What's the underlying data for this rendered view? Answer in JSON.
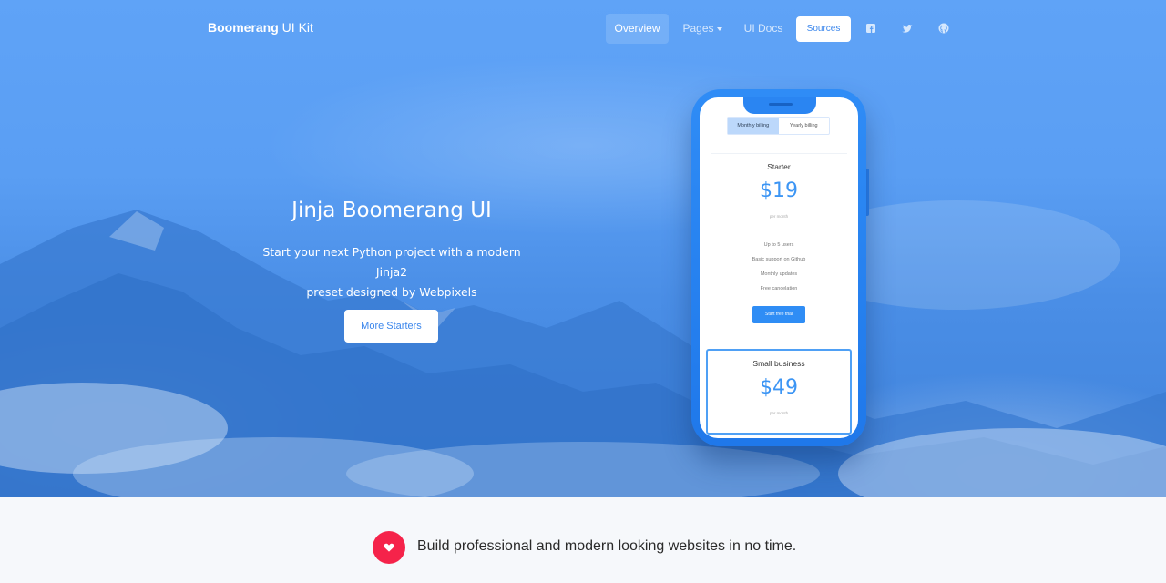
{
  "nav": {
    "brand_bold": "Boomerang",
    "brand_rest": " UI Kit",
    "items": [
      {
        "label": "Overview",
        "active": true
      },
      {
        "label": "Pages",
        "dropdown": true
      },
      {
        "label": "UI Docs"
      }
    ],
    "sources_label": "Sources",
    "social_icons": [
      "facebook-icon",
      "twitter-icon",
      "github-icon"
    ]
  },
  "hero": {
    "title": "Jinja Boomerang UI",
    "subtitle_line1": "Start your next Python project with a modern Jinja2",
    "subtitle_line2": "preset designed by Webpixels",
    "cta_label": "More Starters"
  },
  "phone": {
    "billing_toggle": {
      "monthly": "Monthly billing",
      "yearly": "Yearly billing",
      "selected": "monthly"
    },
    "plans": [
      {
        "name": "Starter",
        "price": "$19",
        "period": "per month",
        "features": [
          "Up to 5 users",
          "Basic support on Github",
          "Monthly updates",
          "Free cancelation"
        ],
        "cta": "Start free trial"
      },
      {
        "name": "Small business",
        "price": "$49",
        "period": "per month"
      }
    ]
  },
  "footer_strip": {
    "icon": "heart-icon",
    "tagline": "Build professional and modern looking websites in no time."
  },
  "colors": {
    "hero_blue": "#5a9ef3",
    "accent_blue": "#3c87ec",
    "phone_blue": "#2a85f2",
    "heart_red": "#f5234a"
  }
}
